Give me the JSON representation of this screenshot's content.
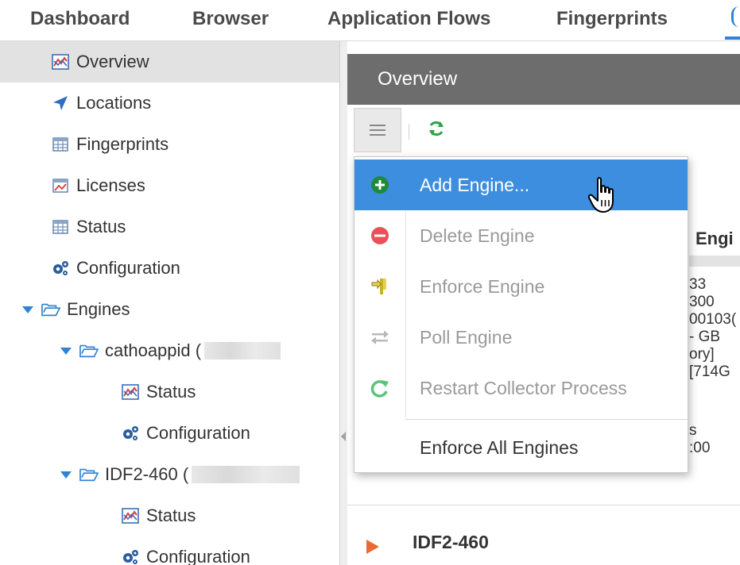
{
  "nav_tabs": [
    "Dashboard",
    "Browser",
    "Application Flows",
    "Fingerprints"
  ],
  "tree": {
    "overview": "Overview",
    "locations": "Locations",
    "fingerprints": "Fingerprints",
    "licenses": "Licenses",
    "status": "Status",
    "configuration": "Configuration",
    "engines": "Engines",
    "engine1": {
      "name": "cathoappid (",
      "status": "Status",
      "configuration": "Configuration"
    },
    "engine2": {
      "name": "IDF2-460 (",
      "status": "Status",
      "configuration": "Configuration"
    }
  },
  "panel": {
    "title": "Overview",
    "background": {
      "heading": "Engi",
      "f1": "33",
      "f2": "300",
      "f3": "00103(",
      "f4": "- GB",
      "f5": "ory]",
      "f6": "[714G",
      "f7": "s",
      "f8": ":00"
    },
    "row2_label": "IDF2-460"
  },
  "menu": {
    "items": [
      {
        "label": "Add Engine...",
        "icon": "add-circle-icon",
        "state": "active"
      },
      {
        "label": "Delete Engine",
        "icon": "delete-circle-icon",
        "state": "disabled"
      },
      {
        "label": "Enforce Engine",
        "icon": "enforce-icon",
        "state": "disabled"
      },
      {
        "label": "Poll Engine",
        "icon": "poll-arrows-icon",
        "state": "disabled"
      },
      {
        "label": "Restart Collector Process",
        "icon": "restart-icon",
        "state": "disabled"
      },
      {
        "label": "Enforce All Engines",
        "icon": "",
        "state": "enabled"
      }
    ]
  },
  "colors": {
    "accent": "#2f82d6",
    "menu_highlight": "#3d8ede",
    "header_bg": "#6d6d6d",
    "add_green": "#1f8a3a",
    "delete_red": "#e8515a",
    "row_arrow": "#ea6b32"
  }
}
